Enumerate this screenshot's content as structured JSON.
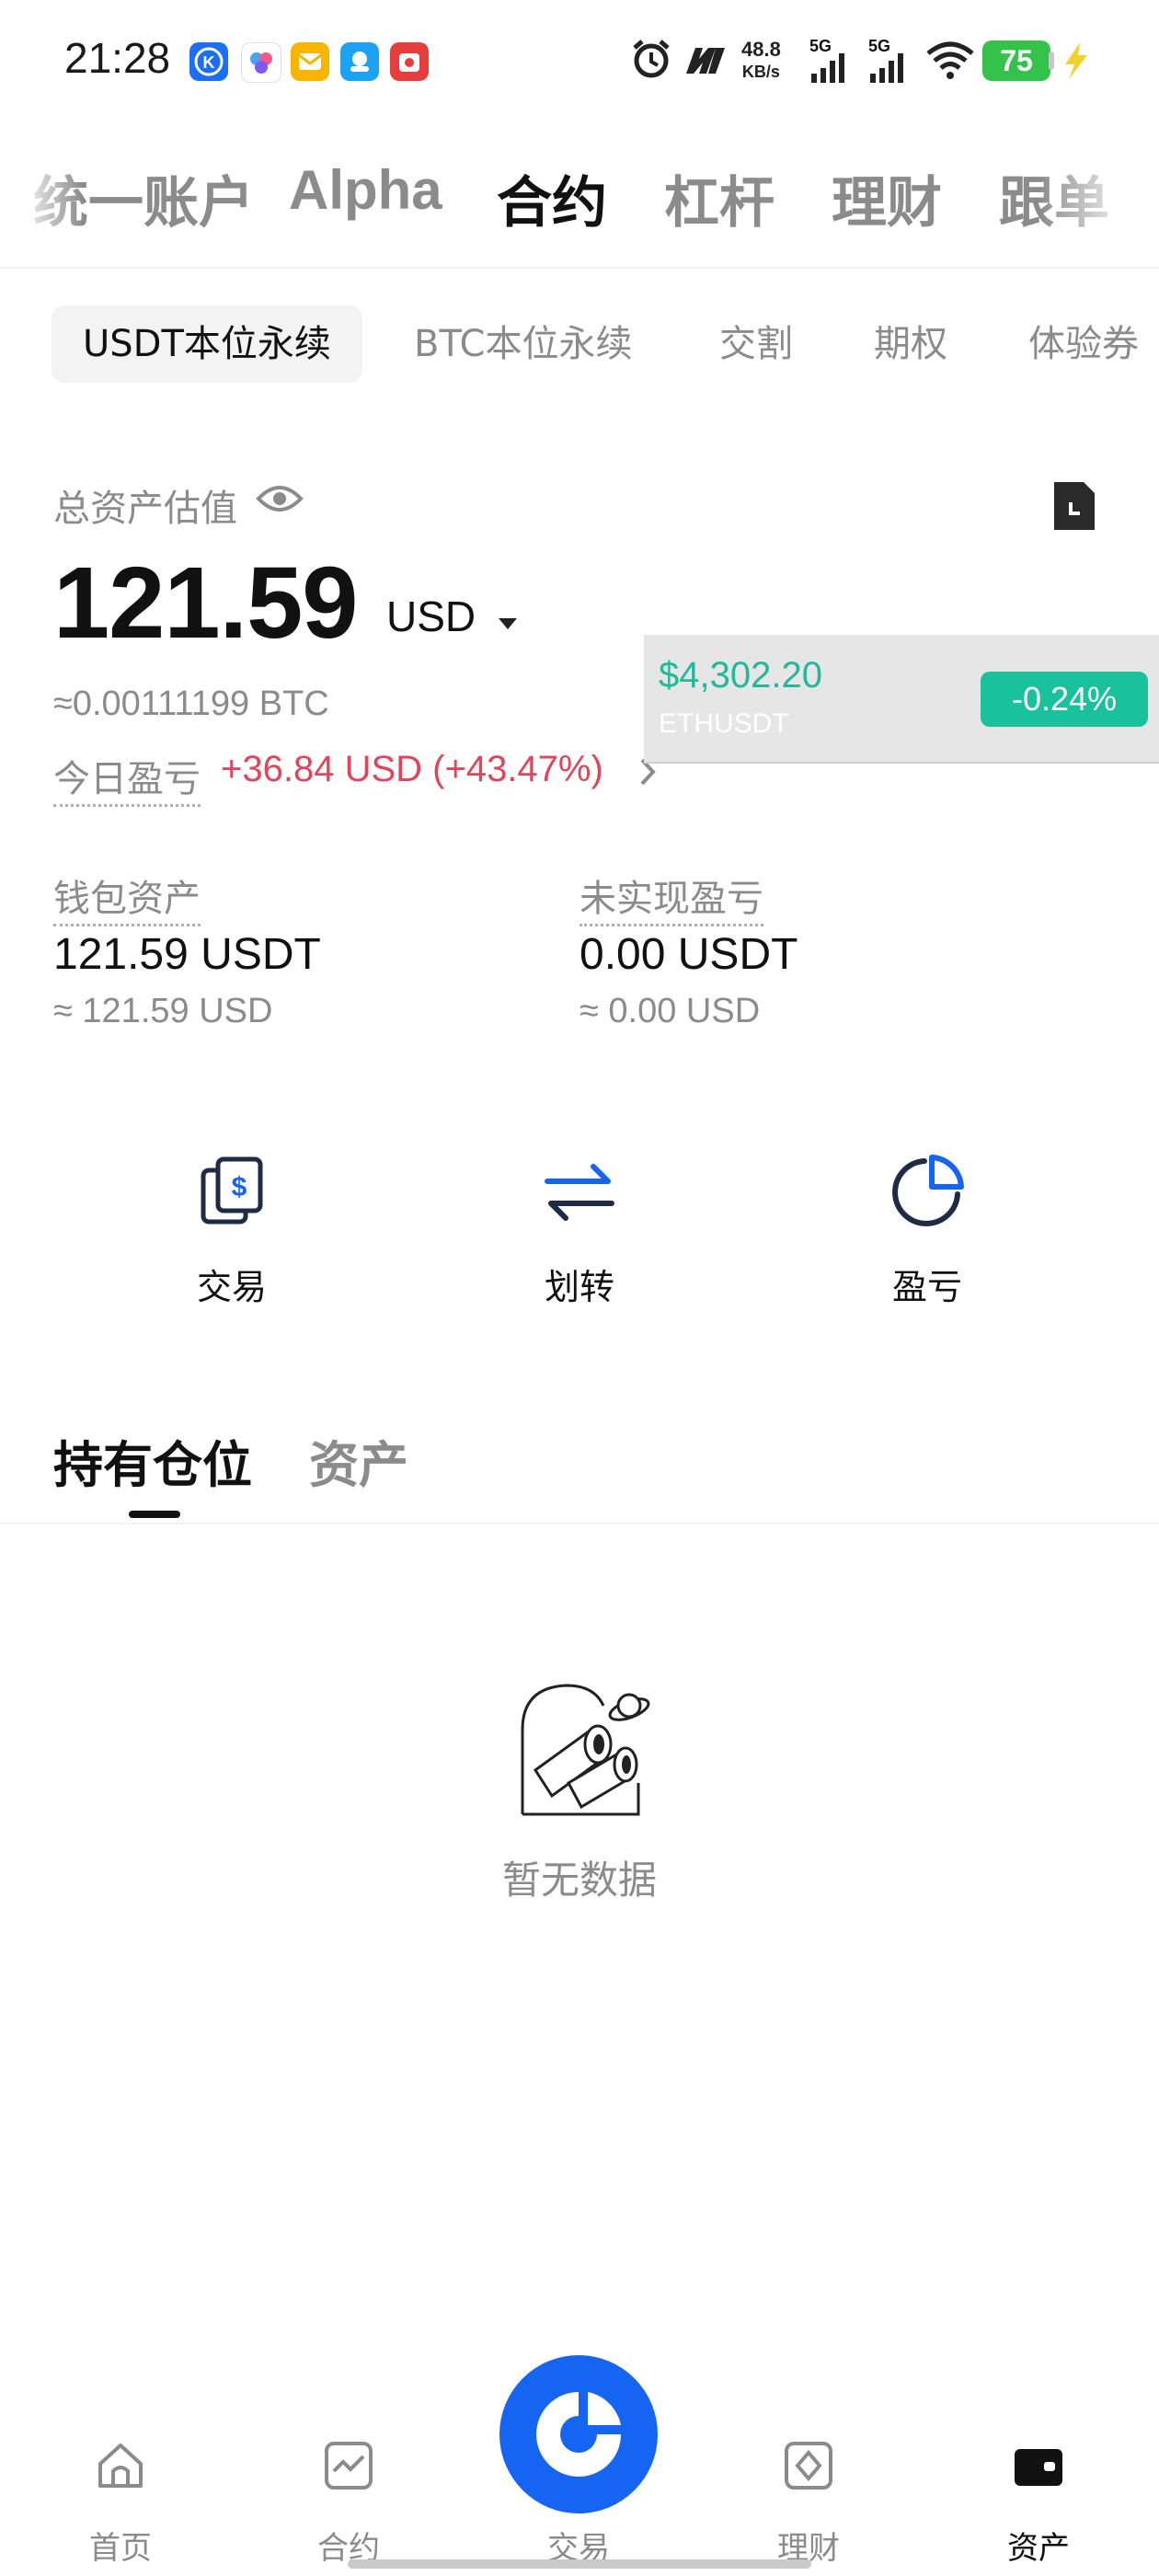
{
  "status_bar": {
    "time": "21:28",
    "net_speed_value": "48.8",
    "net_speed_unit": "KB/s",
    "signal_1": "5G",
    "signal_2": "5G",
    "battery": "75"
  },
  "top_tabs": [
    "统一账户",
    "Alpha",
    "合约",
    "杠杆",
    "理财",
    "跟单"
  ],
  "top_tabs_active": "合约",
  "sub_tabs": [
    "USDT本位永续",
    "BTC本位永续",
    "交割",
    "期权",
    "体验券"
  ],
  "assets": {
    "total_label": "总资产估值",
    "total_value": "121.59",
    "currency": "USD",
    "btc_equivalent": "≈0.00111199 BTC",
    "today_pnl_label": "今日盈亏",
    "today_pnl_value": "+36.84 USD (+43.47%)",
    "wallet_label": "钱包资产",
    "wallet_value": "121.59 USDT",
    "wallet_usd": "≈ 121.59 USD",
    "unrealized_label": "未实现盈亏",
    "unrealized_value": "0.00 USDT",
    "unrealized_usd": "≈ 0.00 USD"
  },
  "ticker": {
    "price": "$4,302.20",
    "symbol": "ETHUSDT",
    "change": "-0.24%"
  },
  "actions": [
    {
      "label": "交易",
      "icon": "trade-dollar-icon"
    },
    {
      "label": "划转",
      "icon": "transfer-arrows-icon"
    },
    {
      "label": "盈亏",
      "icon": "pie-chart-icon"
    }
  ],
  "positions_tabs": [
    "持有仓位",
    "资产"
  ],
  "empty_state": "暂无数据",
  "bottom_nav": [
    {
      "label": "首页",
      "icon": "home-icon"
    },
    {
      "label": "合约",
      "icon": "futures-chart-icon"
    },
    {
      "label": "交易",
      "icon": "trade-logo-icon"
    },
    {
      "label": "理财",
      "icon": "earn-diamond-icon"
    },
    {
      "label": "资产",
      "icon": "wallet-icon"
    }
  ],
  "colors": {
    "accent_blue": "#1664f2",
    "profit_red": "#e0465b",
    "ticker_green": "#19c29c",
    "muted": "#8b8b8b"
  }
}
